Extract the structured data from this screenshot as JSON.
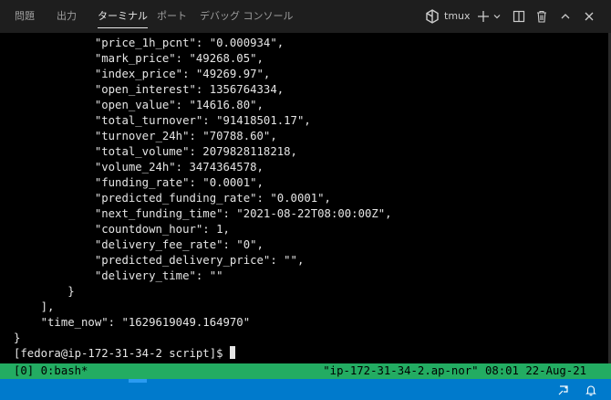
{
  "tabs": [
    {
      "label": "問題",
      "active": false
    },
    {
      "label": "出力",
      "active": false
    },
    {
      "label": "ターミナル",
      "active": true
    },
    {
      "label": "ポート",
      "active": false
    },
    {
      "label": "デバッグ コンソール",
      "active": false
    }
  ],
  "terminal_profile": {
    "label": "tmux",
    "icon": "tmux-icon"
  },
  "toolbar_icons": [
    "plus-icon",
    "chevron-down-icon",
    "split-icon",
    "trash-icon",
    "chevron-up-icon",
    "close-icon"
  ],
  "terminal_lines": [
    "            \"price_1h_pcnt\": \"0.000934\",",
    "            \"mark_price\": \"49268.05\",",
    "            \"index_price\": \"49269.97\",",
    "            \"open_interest\": 1356764334,",
    "            \"open_value\": \"14616.80\",",
    "            \"total_turnover\": \"91418501.17\",",
    "            \"turnover_24h\": \"70788.60\",",
    "            \"total_volume\": 2079828118218,",
    "            \"volume_24h\": 3474364578,",
    "            \"funding_rate\": \"0.0001\",",
    "            \"predicted_funding_rate\": \"0.0001\",",
    "            \"next_funding_time\": \"2021-08-22T08:00:00Z\",",
    "            \"countdown_hour\": 1,",
    "            \"delivery_fee_rate\": \"0\",",
    "            \"predicted_delivery_price\": \"\",",
    "            \"delivery_time\": \"\"",
    "        }",
    "    ],",
    "    \"time_now\": \"1629619049.164970\"",
    "}"
  ],
  "prompt": "[fedora@ip-172-31-34-2 script]$ ",
  "tmux_status": {
    "left": "[0] 0:bash*",
    "right": "\"ip-172-31-34-2.ap-nor\" 08:01 22-Aug-21"
  },
  "colors": {
    "background": "#1e1e1e",
    "terminal_bg": "#000000",
    "tmux_bar": "#23ac62",
    "statusbar": "#007acc"
  },
  "statusbar_icons": [
    "remote-feedback-icon",
    "bell-icon"
  ]
}
